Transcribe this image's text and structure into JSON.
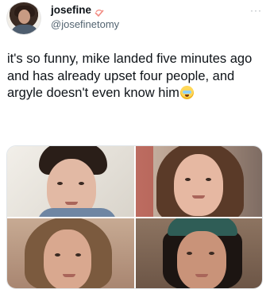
{
  "tweet": {
    "author": {
      "display_name": "josefine",
      "handle": "@josefinetomy",
      "avatar_icon": "profile-avatar",
      "verified_or_lock_icon": "lock-icon"
    },
    "more_icon_glyph": "···",
    "text": "it's so funny, mike landed five minutes ago and has already upset four people, and argyle doesn't even know him",
    "text_emoji": "crying-laughing-emoji",
    "media": {
      "photos": [
        {
          "icon": "photo-boy-dark-hair"
        },
        {
          "icon": "photo-girl-smiling"
        },
        {
          "icon": "photo-man-long-hair"
        },
        {
          "icon": "photo-boy-green-beanie"
        }
      ]
    }
  },
  "colors": {
    "text_primary": "#0f1419",
    "text_secondary": "#536471",
    "border": "#e1e6ea"
  }
}
